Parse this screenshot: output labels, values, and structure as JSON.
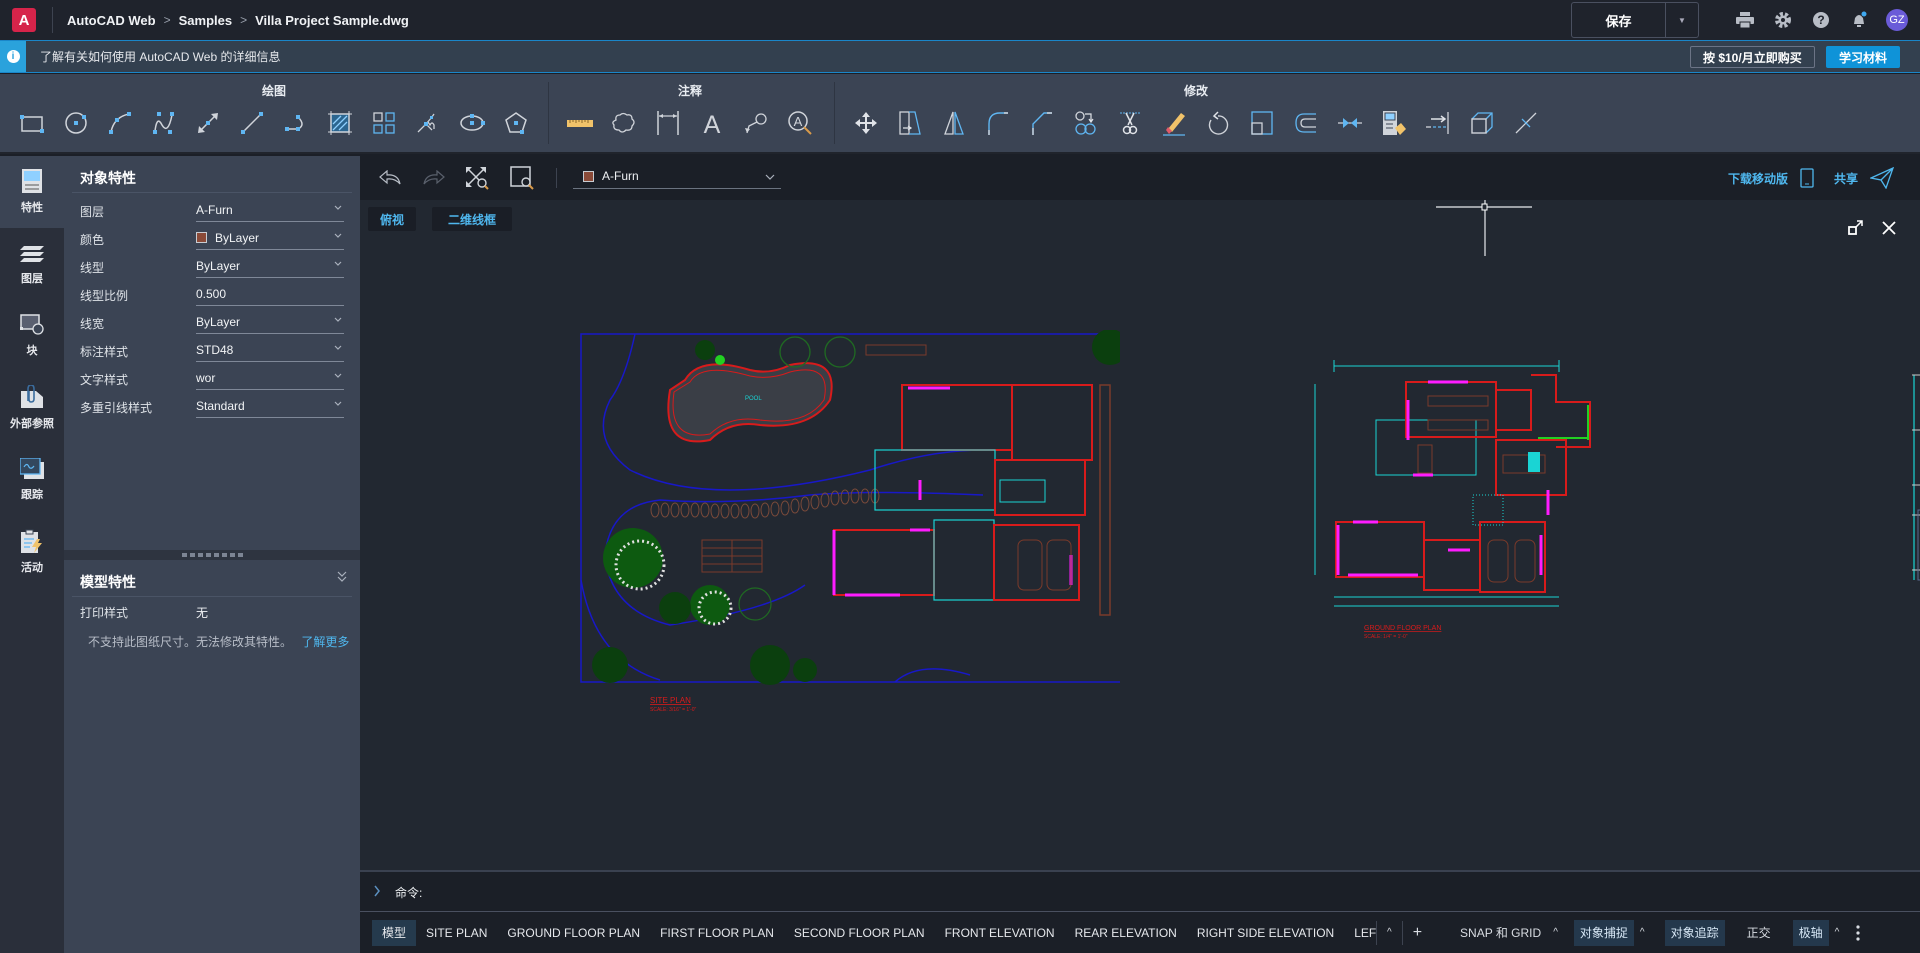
{
  "app": {
    "logo_letter": "A",
    "breadcrumb": [
      "AutoCAD Web",
      "Samples",
      "Villa Project Sample.dwg"
    ],
    "save_label": "保存",
    "user_initials": "GZ",
    "accent_color": "#0f93d8"
  },
  "infobar": {
    "message": "了解有关如何使用 AutoCAD Web 的详细信息",
    "buy_label": "按 $10/月立即购买",
    "learn_label": "学习材料"
  },
  "ribbon": {
    "groups": [
      {
        "title": "绘图",
        "tools": [
          "rectangle",
          "circle",
          "arc",
          "spline",
          "dimension-line",
          "line",
          "polyline",
          "hatch",
          "array",
          "insert-block",
          "ellipse",
          "polygon"
        ]
      },
      {
        "title": "注释",
        "tools": [
          "measure",
          "revision-cloud",
          "linear-dimension",
          "text",
          "leader",
          "find-text"
        ]
      },
      {
        "title": "修改",
        "tools": [
          "move",
          "stretch",
          "mirror",
          "fillet",
          "chamfer",
          "copy",
          "trim",
          "erase",
          "rotate",
          "scale",
          "offset",
          "join",
          "match-properties",
          "extend",
          "explode-3d",
          "break"
        ]
      }
    ]
  },
  "rail": {
    "items": [
      {
        "label": "特性",
        "icon": "properties-icon",
        "active": true
      },
      {
        "label": "图层",
        "icon": "layers-icon",
        "active": false
      },
      {
        "label": "块",
        "icon": "block-icon",
        "active": false
      },
      {
        "label": "外部参照",
        "icon": "xref-icon",
        "active": false
      },
      {
        "label": "跟踪",
        "icon": "trace-icon",
        "active": false
      },
      {
        "label": "活动",
        "icon": "activity-icon",
        "active": false
      }
    ]
  },
  "properties": {
    "title": "对象特性",
    "rows": [
      {
        "label": "图层",
        "value": "A-Furn",
        "dropdown": true
      },
      {
        "label": "颜色",
        "value": "ByLayer",
        "dropdown": true,
        "swatch": "#8a4a38"
      },
      {
        "label": "线型",
        "value": "ByLayer",
        "dropdown": true
      },
      {
        "label": "线型比例",
        "value": "0.500",
        "dropdown": false
      },
      {
        "label": "线宽",
        "value": "ByLayer",
        "dropdown": true
      },
      {
        "label": "标注样式",
        "value": "STD48",
        "dropdown": true
      },
      {
        "label": "文字样式",
        "value": "wor",
        "dropdown": true
      },
      {
        "label": "多重引线样式",
        "value": "Standard",
        "dropdown": true
      }
    ]
  },
  "model_properties": {
    "title": "模型特性",
    "print_style_label": "打印样式",
    "print_style_value": "无",
    "notice": "不支持此图纸尺寸。无法修改其特性。",
    "learn_more": "了解更多"
  },
  "canvas_toolbar": {
    "current_layer": "A-Furn",
    "layer_color": "#8a4a38",
    "download_mobile": "下载移动版",
    "share": "共享"
  },
  "viewport": {
    "view_label": "俯视",
    "visual_style_label": "二维线框"
  },
  "drawings": {
    "site_plan_title": "SITE PLAN",
    "site_plan_scale": "SCALE: 3/16\" = 1'-0\"",
    "site_plan_pool_label": "POOL",
    "ground_floor_title": "GROUND FLOOR PLAN",
    "ground_floor_scale": "SCALE: 1/4\" = 1'-0\""
  },
  "command": {
    "prompt": "命令:"
  },
  "layout_tabs": [
    {
      "label": "模型",
      "active": true
    },
    {
      "label": "SITE PLAN",
      "active": false
    },
    {
      "label": "GROUND FLOOR PLAN",
      "active": false
    },
    {
      "label": "FIRST FLOOR PLAN",
      "active": false
    },
    {
      "label": "SECOND FLOOR PLAN",
      "active": false
    },
    {
      "label": "FRONT ELEVATION",
      "active": false
    },
    {
      "label": "REAR ELEVATION",
      "active": false
    },
    {
      "label": "RIGHT SIDE ELEVATION",
      "active": false
    },
    {
      "label": "LEFT SIDE EL",
      "active": false
    }
  ],
  "status_toggles": [
    {
      "label": "SNAP 和 GRID",
      "on": false,
      "caret": true
    },
    {
      "label": "对象捕捉",
      "on": true,
      "caret": true
    },
    {
      "label": "对象追踪",
      "on": true,
      "caret": false
    },
    {
      "label": "正交",
      "on": false,
      "caret": false
    },
    {
      "label": "极轴",
      "on": true,
      "caret": true
    }
  ]
}
